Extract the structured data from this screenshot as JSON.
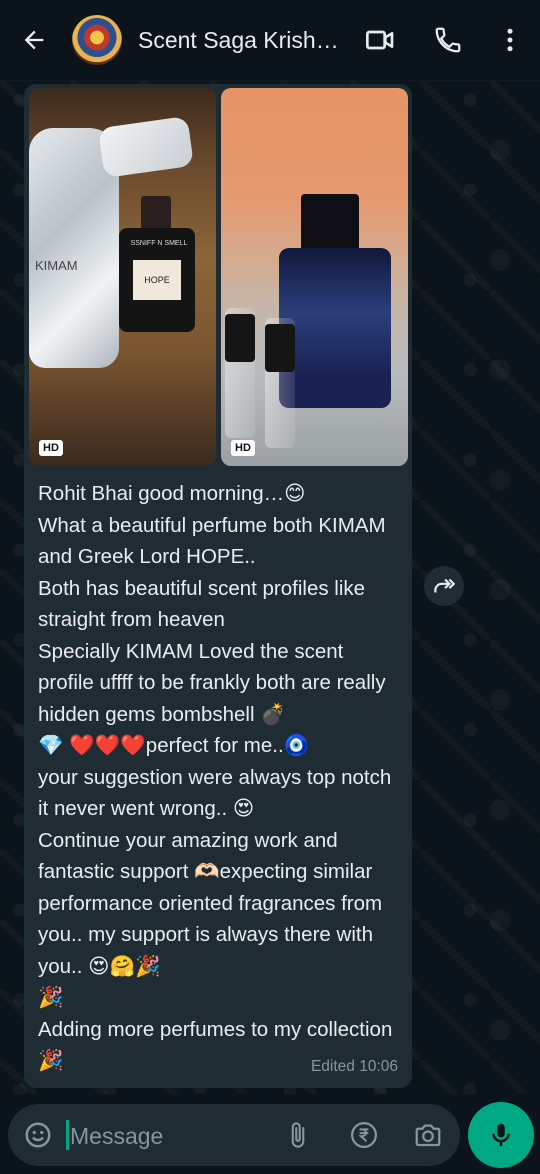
{
  "header": {
    "contact_name": "Scent Saga Krish…",
    "icons": [
      "back-arrow-icon",
      "video-call-icon",
      "phone-icon",
      "more-vert-icon"
    ]
  },
  "message": {
    "images": [
      {
        "badge": "HD",
        "bottle_label": "HOPE",
        "brand": "SSNIFF N SMELL",
        "bag_text": "KIMAM"
      },
      {
        "badge": "HD"
      }
    ],
    "text": "Rohit Bhai good morning…😊\nWhat a beautiful perfume both KIMAM and Greek Lord HOPE..\nBoth has beautiful scent profiles like straight from heaven\nSpecially KIMAM Loved the scent profile uffff to be frankly both are really hidden gems bombshell 💣\n💎 ❤️❤️❤️perfect for me..🧿\nyour suggestion were always top notch it never went wrong.. 😍\nContinue your amazing work and fantastic support 🫶🏻expecting similar performance oriented fragrances from you.. my support is always there with you.. 😍🤗🎉\n🎉\nAdding more perfumes to my collection 🎉",
    "status": "Edited",
    "time": "10:06"
  },
  "composer": {
    "placeholder": "Message",
    "icons": [
      "sticker-icon",
      "attach-icon",
      "rupee-payment-icon",
      "camera-icon",
      "mic-icon"
    ]
  },
  "colors": {
    "background": "#0b141a",
    "bubble": "#1f2c34",
    "accent": "#00a884",
    "muted_text": "#8696a0"
  }
}
